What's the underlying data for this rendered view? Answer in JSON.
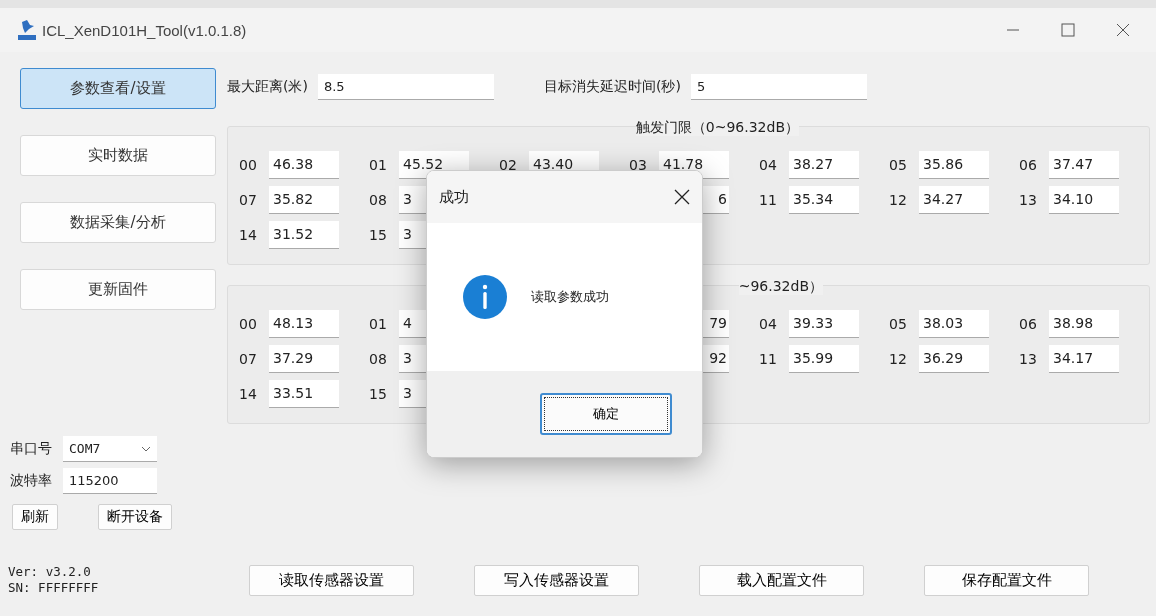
{
  "window": {
    "title": "ICL_XenD101H_Tool(v1.0.1.8)"
  },
  "nav": [
    {
      "label": "参数查看/设置",
      "selected": true
    },
    {
      "label": "实时数据",
      "selected": false
    },
    {
      "label": "数据采集/分析",
      "selected": false
    },
    {
      "label": "更新固件",
      "selected": false
    }
  ],
  "fields": [
    {
      "label": "最大距离(米)",
      "value": "8.5"
    },
    {
      "label": "目标消失延迟时间(秒)",
      "value": "5"
    }
  ],
  "groups": [
    {
      "title": "触发门限（0~96.32dB）",
      "rows": [
        [
          {
            "index": "00",
            "value": "46.38"
          },
          {
            "index": "01",
            "value": "45.52"
          },
          {
            "index": "02",
            "value": "43.40"
          },
          {
            "index": "03",
            "value": "41.78"
          },
          {
            "index": "04",
            "value": "38.27"
          },
          {
            "index": "05",
            "value": "35.86"
          },
          {
            "index": "06",
            "value": "37.47"
          }
        ],
        [
          {
            "index": "07",
            "value": "35.82"
          },
          {
            "index": "08",
            "value": "3"
          },
          {},
          {
            "value": "6"
          },
          {
            "index": "11",
            "value": "35.34"
          },
          {
            "index": "12",
            "value": "34.27"
          },
          {
            "index": "13",
            "value": "34.10"
          }
        ],
        [
          {
            "index": "14",
            "value": "31.52"
          },
          {
            "index": "15",
            "value": "3"
          }
        ]
      ]
    },
    {
      "title": "~96.32dB）",
      "rows": [
        [
          {
            "index": "00",
            "value": "48.13"
          },
          {
            "index": "01",
            "value": "4"
          },
          {},
          {
            "value": "79"
          },
          {
            "index": "04",
            "value": "39.33"
          },
          {
            "index": "05",
            "value": "38.03"
          },
          {
            "index": "06",
            "value": "38.98"
          }
        ],
        [
          {
            "index": "07",
            "value": "37.29"
          },
          {
            "index": "08",
            "value": "3"
          },
          {},
          {
            "value": "92"
          },
          {
            "index": "11",
            "value": "35.99"
          },
          {
            "index": "12",
            "value": "36.29"
          },
          {
            "index": "13",
            "value": "34.17"
          }
        ],
        [
          {
            "index": "14",
            "value": "33.51"
          },
          {
            "index": "15",
            "value": "3"
          }
        ]
      ]
    }
  ],
  "serial": {
    "port_label": "串口号",
    "port": "COM7",
    "baud_label": "波特率",
    "baud": "115200",
    "buttons": [
      "刷新",
      "断开设备"
    ]
  },
  "version": "Ver: v3.2.0",
  "sn": "SN: FFFFFFFF",
  "actions": [
    "读取传感器设置",
    "写入传感器设置",
    "载入配置文件",
    "保存配置文件"
  ],
  "dialog": {
    "title": "成功",
    "message": "读取参数成功",
    "button": "确定"
  }
}
